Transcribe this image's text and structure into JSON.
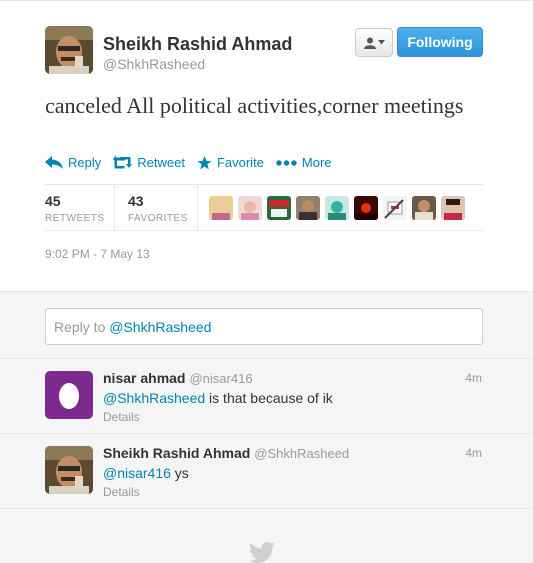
{
  "tweet": {
    "author_name": "Sheikh Rashid Ahmad",
    "author_handle": "@ShkhRasheed",
    "follow_label": "Following",
    "text": "canceled All political activities,corner meetings",
    "actions": {
      "reply": "Reply",
      "retweet": "Retweet",
      "favorite": "Favorite",
      "more": "More"
    },
    "stats": {
      "retweets_count": "45",
      "retweets_label": "RETWEETS",
      "favorites_count": "43",
      "favorites_label": "FAVORITES"
    },
    "timestamp": "9:02 PM - 7 May 13"
  },
  "reply_box": {
    "prefix": "Reply to ",
    "mention": "@ShkhRasheed"
  },
  "replies": [
    {
      "name": "nisar ahmad",
      "handle": "@nisar416",
      "time": "4m",
      "mention": "@ShkhRasheed",
      "text": " is that because of ik",
      "details": "Details"
    },
    {
      "name": "Sheikh Rashid Ahmad",
      "handle": "@ShkhRasheed",
      "time": "4m",
      "mention": "@nisar416",
      "text": " ys",
      "details": "Details"
    }
  ],
  "colors": {
    "link": "#0084b4",
    "follow_button": "#2a93dc",
    "muted": "#999999"
  }
}
